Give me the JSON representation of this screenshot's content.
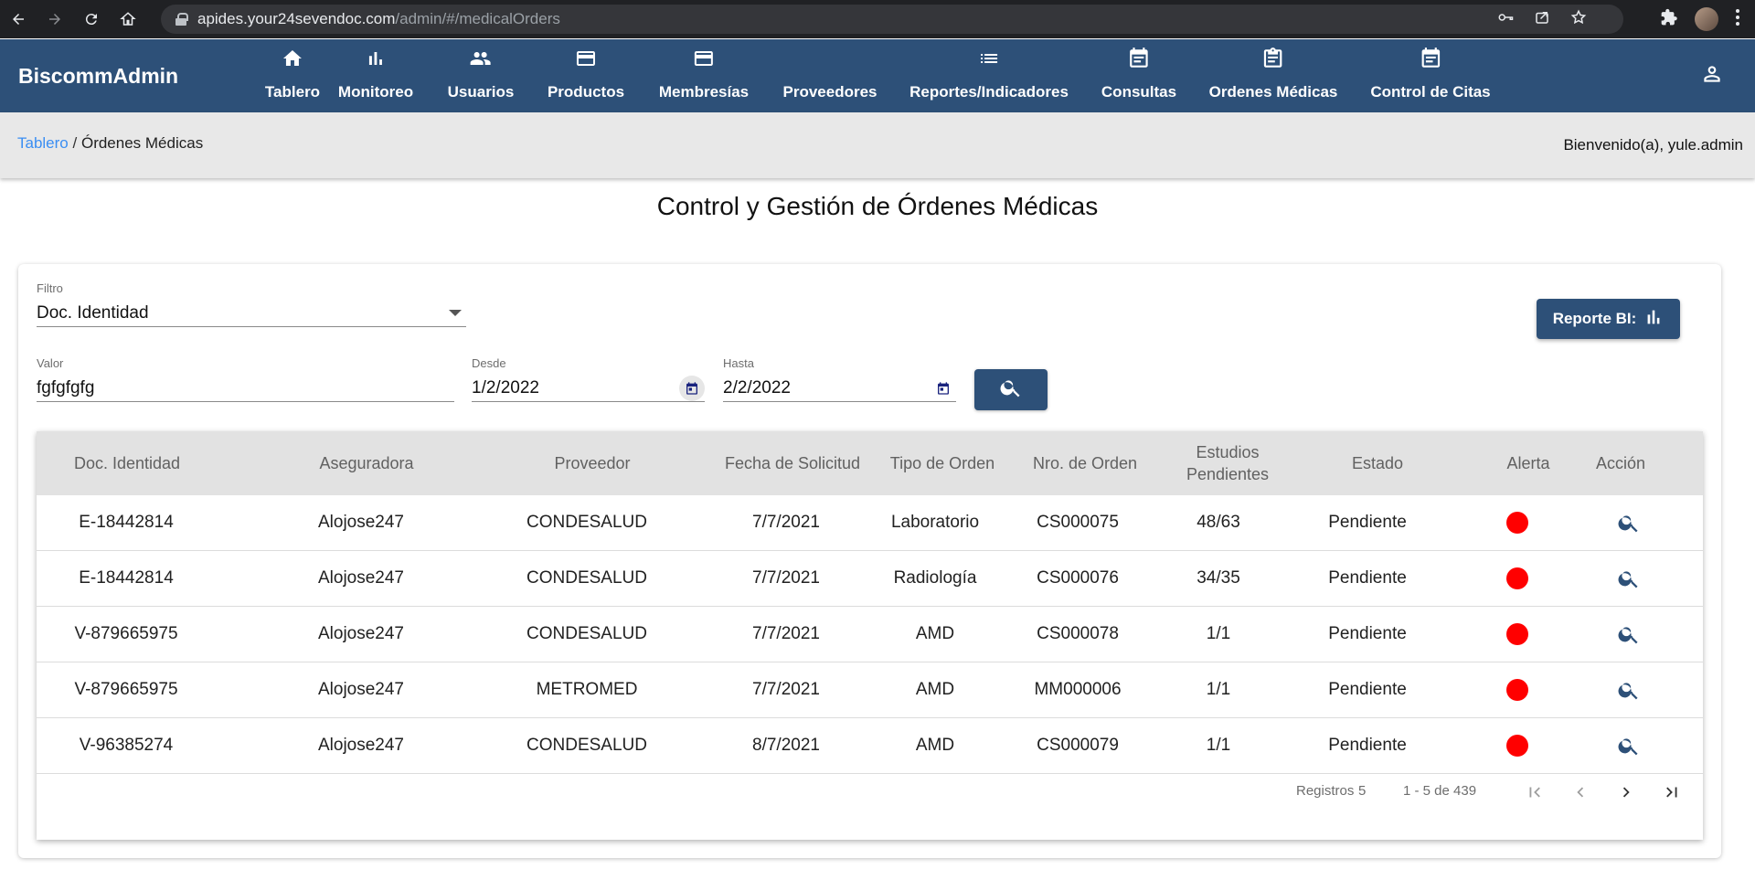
{
  "browser": {
    "url_host": "apides.your24sevendoc.com",
    "url_path": "/admin/#/medicalOrders"
  },
  "app": {
    "brand": "BiscommAdmin",
    "nav": [
      {
        "label": "Tablero",
        "icon": "home-icon"
      },
      {
        "label": "Monitoreo",
        "icon": "bar-chart-icon"
      },
      {
        "label": "Usuarios",
        "icon": "people-icon"
      },
      {
        "label": "Productos",
        "icon": "credit-card-icon"
      },
      {
        "label": "Membresías",
        "icon": "credit-card-icon"
      },
      {
        "label": "Proveedores",
        "icon": "none"
      },
      {
        "label": "Reportes/Indicadores",
        "icon": "list-icon"
      },
      {
        "label": "Consultas",
        "icon": "event-note-icon"
      },
      {
        "label": "Ordenes Médicas",
        "icon": "assignment-icon"
      },
      {
        "label": "Control de Citas",
        "icon": "event-note-icon"
      }
    ]
  },
  "breadcrumb": {
    "root": "Tablero",
    "separator": "/",
    "current": "Órdenes Médicas"
  },
  "welcome": "Bienvenido(a), yule.admin",
  "page_title": "Control y Gestión de Órdenes Médicas",
  "filters": {
    "filter_label": "Filtro",
    "filter_value": "Doc. Identidad",
    "value_label": "Valor",
    "value_value": "fgfgfgfg",
    "from_label": "Desde",
    "from_value": "1/2/2022",
    "to_label": "Hasta",
    "to_value": "2/2/2022"
  },
  "report_button": "Reporte BI:",
  "table": {
    "headers": [
      "Doc. Identidad",
      "Aseguradora",
      "Proveedor",
      "Fecha de Solicitud",
      "Tipo de Orden",
      "Nro. de Orden",
      "Estudios Pendientes",
      "Estado",
      "Alerta",
      "Acción"
    ],
    "rows": [
      {
        "doc": "E-18442814",
        "insurer": "Alojose247",
        "provider": "CONDESALUD",
        "date": "7/7/2021",
        "type": "Laboratorio",
        "order": "CS000075",
        "pending": "48/63",
        "status": "Pendiente"
      },
      {
        "doc": "E-18442814",
        "insurer": "Alojose247",
        "provider": "CONDESALUD",
        "date": "7/7/2021",
        "type": "Radiología",
        "order": "CS000076",
        "pending": "34/35",
        "status": "Pendiente"
      },
      {
        "doc": "V-879665975",
        "insurer": "Alojose247",
        "provider": "CONDESALUD",
        "date": "7/7/2021",
        "type": "AMD",
        "order": "CS000078",
        "pending": "1/1",
        "status": "Pendiente"
      },
      {
        "doc": "V-879665975",
        "insurer": "Alojose247",
        "provider": "METROMED",
        "date": "7/7/2021",
        "type": "AMD",
        "order": "MM000006",
        "pending": "1/1",
        "status": "Pendiente"
      },
      {
        "doc": "V-96385274",
        "insurer": "Alojose247",
        "provider": "CONDESALUD",
        "date": "8/7/2021",
        "type": "AMD",
        "order": "CS000079",
        "pending": "1/1",
        "status": "Pendiente"
      }
    ]
  },
  "paginator": {
    "page_size_label": "Registros",
    "page_size": "5",
    "range": "1 - 5 de 439"
  },
  "colors": {
    "primary": "#2d5078",
    "alert": "#ff0000",
    "link": "#3a8ef3"
  }
}
